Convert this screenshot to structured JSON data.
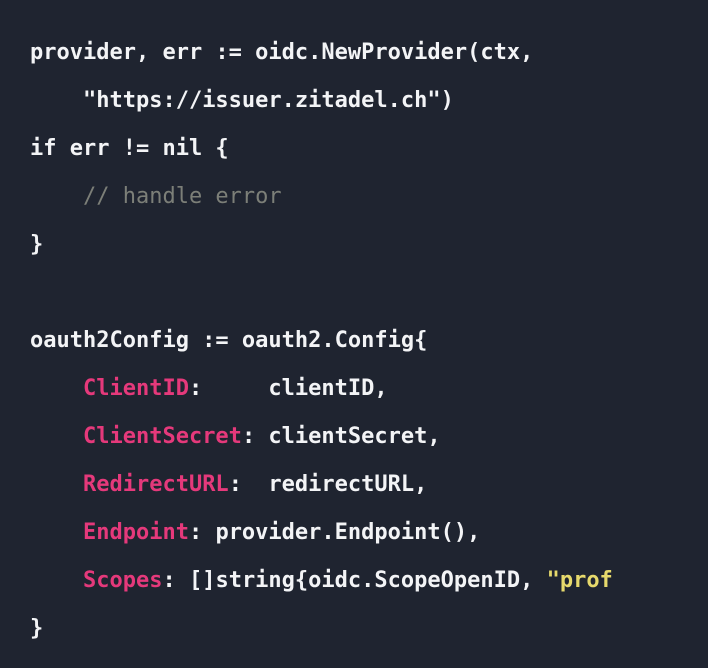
{
  "theme": {
    "background": "#1f2430",
    "text": "#f3f4f6",
    "key": "#e5397b",
    "string": "#e6d96c",
    "comment": "#7c7f78"
  },
  "code": {
    "language": "go",
    "lines": [
      [
        {
          "t": "plain",
          "v": "provider, err := oidc.NewProvider(ctx,"
        }
      ],
      [
        {
          "t": "plain",
          "v": "    "
        },
        {
          "t": "plain",
          "v": "\"https://issuer.zitadel.ch\")"
        }
      ],
      [
        {
          "t": "plain",
          "v": "if err != nil {"
        }
      ],
      [
        {
          "t": "plain",
          "v": "    "
        },
        {
          "t": "comment",
          "v": "// handle error"
        }
      ],
      [
        {
          "t": "plain",
          "v": "}"
        }
      ],
      [
        {
          "t": "plain",
          "v": ""
        }
      ],
      [
        {
          "t": "plain",
          "v": "oauth2Config := oauth2.Config{"
        }
      ],
      [
        {
          "t": "plain",
          "v": "    "
        },
        {
          "t": "key",
          "v": "ClientID"
        },
        {
          "t": "plain",
          "v": ":     clientID,"
        }
      ],
      [
        {
          "t": "plain",
          "v": "    "
        },
        {
          "t": "key",
          "v": "ClientSecret"
        },
        {
          "t": "plain",
          "v": ": clientSecret,"
        }
      ],
      [
        {
          "t": "plain",
          "v": "    "
        },
        {
          "t": "key",
          "v": "RedirectURL"
        },
        {
          "t": "plain",
          "v": ":  redirectURL,"
        }
      ],
      [
        {
          "t": "plain",
          "v": "    "
        },
        {
          "t": "key",
          "v": "Endpoint"
        },
        {
          "t": "plain",
          "v": ": provider.Endpoint(),"
        }
      ],
      [
        {
          "t": "plain",
          "v": "    "
        },
        {
          "t": "key",
          "v": "Scopes"
        },
        {
          "t": "plain",
          "v": ": []string{oidc.ScopeOpenID, "
        },
        {
          "t": "str",
          "v": "\"prof"
        }
      ],
      [
        {
          "t": "plain",
          "v": "}"
        }
      ]
    ]
  }
}
